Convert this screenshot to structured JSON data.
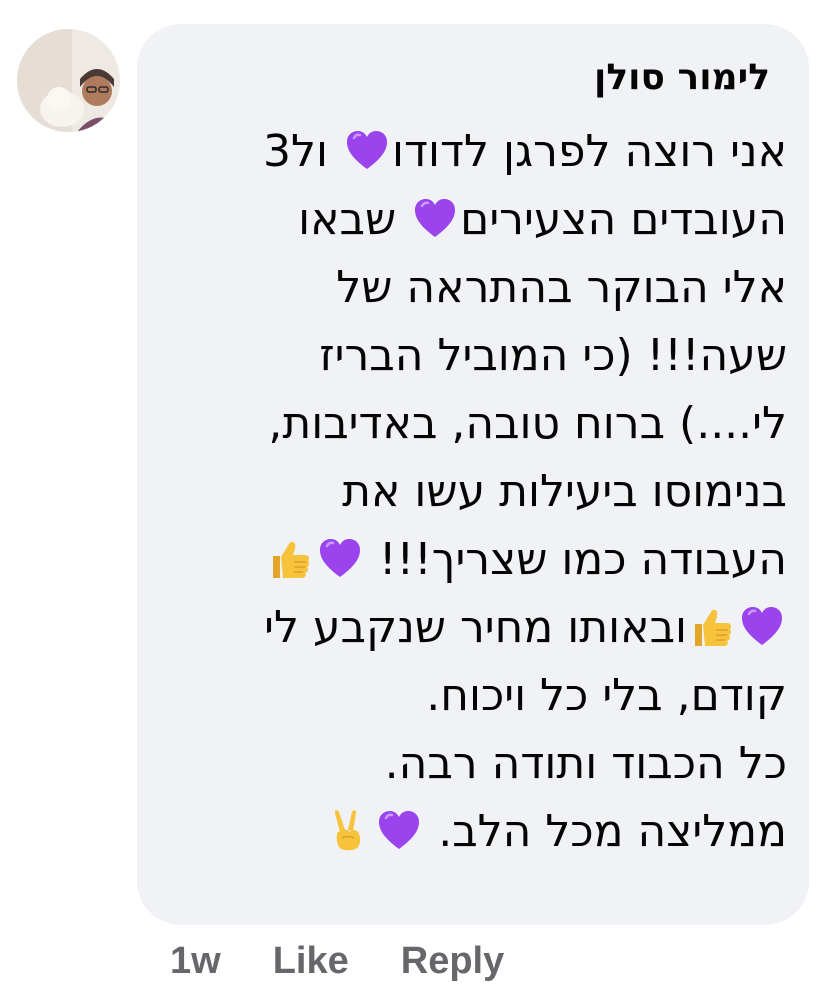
{
  "comment": {
    "author": "לימור סולן",
    "lines": [
      [
        {
          "t": "text",
          "v": "אני רוצה לפרגן לדודו"
        },
        {
          "t": "emoji",
          "v": "purple-heart"
        },
        {
          "t": "text",
          "v": " ול3"
        }
      ],
      [
        {
          "t": "text",
          "v": "העובדים הצעירים"
        },
        {
          "t": "emoji",
          "v": "purple-heart"
        },
        {
          "t": "text",
          "v": " שבאו"
        }
      ],
      [
        {
          "t": "text",
          "v": "אלי הבוקר בהתראה של"
        }
      ],
      [
        {
          "t": "text",
          "v": "שעה!!! (כי המוביל הבריז"
        }
      ],
      [
        {
          "t": "text",
          "v": "לי....) ברוח טובה, באדיבות,"
        }
      ],
      [
        {
          "t": "text",
          "v": "בנימוסו ביעילות עשו את"
        }
      ],
      [
        {
          "t": "text",
          "v": "העבודה כמו שצריך!!! "
        },
        {
          "t": "emoji",
          "v": "purple-heart"
        },
        {
          "t": "emoji",
          "v": "thumbs-up"
        }
      ],
      [
        {
          "t": "emoji",
          "v": "purple-heart"
        },
        {
          "t": "emoji",
          "v": "thumbs-up"
        },
        {
          "t": "text",
          "v": "ובאותו מחיר שנקבע לי"
        }
      ],
      [
        {
          "t": "text",
          "v": "קודם, בלי כל ויכוח."
        }
      ],
      [
        {
          "t": "text",
          "v": "כל הכבוד ותודה רבה."
        }
      ],
      [
        {
          "t": "text",
          "v": "ממליצה מכל הלב. "
        },
        {
          "t": "emoji",
          "v": "purple-heart"
        },
        {
          "t": "emoji",
          "v": "victory-hand"
        }
      ]
    ],
    "actions": {
      "time": "1w",
      "like": "Like",
      "reply": "Reply"
    }
  },
  "colors": {
    "bubble": "#f0f2f5",
    "text": "#050505",
    "meta": "#65676b",
    "heart": "#9b44ee",
    "thumb": "#f6c33a"
  },
  "icons": {
    "purple-heart": "purple-heart-icon",
    "thumbs-up": "thumbs-up-icon",
    "victory-hand": "victory-hand-icon"
  }
}
